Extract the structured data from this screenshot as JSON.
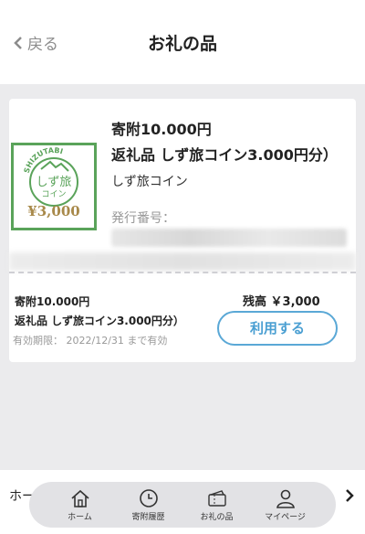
{
  "header": {
    "back_label": "戻る",
    "title": "お礼の品"
  },
  "card": {
    "donation": "寄附10.000円",
    "gift": "返礼品 しず旅コイン3.000円分）",
    "coin_name": "しず旅コイン",
    "issue_no_label": "発行番号：",
    "logo": {
      "arc_text": "SHIZUTABI",
      "name": "しず旅",
      "sub": "コイン",
      "price": "¥3,000"
    },
    "bottom": {
      "donation": "寄附10.000円",
      "gift": "返礼品 しず旅コイン3.000円分）",
      "expiry": "有効期限： 2022/12/31 まで有効",
      "balance": "残高 ￥3,000",
      "use_button": "利用する"
    }
  },
  "bottom_strip": {
    "text": "ホー"
  },
  "tabbar": {
    "items": [
      {
        "label": "ホーム",
        "icon": "home-icon"
      },
      {
        "label": "寄附履歴",
        "icon": "clock-icon"
      },
      {
        "label": "お礼の品",
        "icon": "ticket-icon"
      },
      {
        "label": "マイページ",
        "icon": "user-icon"
      }
    ]
  },
  "colors": {
    "accent": "#4a9fd2",
    "logo_green": "#5aa35a",
    "logo_gold": "#a8894a"
  }
}
